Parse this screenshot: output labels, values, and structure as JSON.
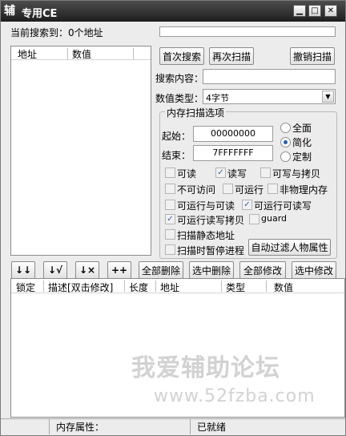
{
  "window": {
    "icon_glyph": "辅",
    "title": "专用CE",
    "minimize": "▁",
    "maximize": "□",
    "close": "✕"
  },
  "status_top": "当前搜索到：0个地址",
  "left_list": {
    "columns": [
      "地址",
      "数值"
    ]
  },
  "buttons": {
    "first_scan": "首次搜索",
    "next_scan": "再次扫描",
    "undo_scan": "撤销扫描",
    "auto_filter": "自动过滤人物属性"
  },
  "search": {
    "label": "搜索内容：",
    "value": ""
  },
  "value_type": {
    "label": "数值类型：",
    "selected": "4字节"
  },
  "mem_options": {
    "title": "内存扫描选项",
    "start_label": "起始：",
    "start_value": "00000000",
    "end_label": "结束：",
    "end_value": "7FFFFFFF",
    "radios": [
      {
        "label": "全面",
        "checked": false
      },
      {
        "label": "简化",
        "checked": true
      },
      {
        "label": "定制",
        "checked": false
      }
    ],
    "checks": {
      "readable": {
        "label": "可读",
        "checked": false
      },
      "readwrite": {
        "label": "读写",
        "checked": true
      },
      "writecopy": {
        "label": "可写与拷贝",
        "checked": false
      },
      "noaccess": {
        "label": "不可访问",
        "checked": false
      },
      "executable": {
        "label": "可运行",
        "checked": false
      },
      "nonphysical": {
        "label": "非物理内存",
        "checked": false
      },
      "exec_read": {
        "label": "可运行与可读",
        "checked": false
      },
      "exec_readwrite": {
        "label": "可运行可读写",
        "checked": true
      },
      "exec_rw_copy": {
        "label": "可运行读写拷贝",
        "checked": true
      },
      "guard": {
        "label": "guard",
        "checked": false
      },
      "static_addr": {
        "label": "扫描静态地址",
        "checked": false
      },
      "pause_scan": {
        "label": "扫描时暂停进程",
        "checked": false
      }
    }
  },
  "toolbar": {
    "down_arrow": "↓↓",
    "down_check": "↓√",
    "down_x": "↓×",
    "plus": "++",
    "delete_all": "全部删除",
    "delete_selected": "选中删除",
    "modify_all": "全部修改",
    "modify_selected": "选中修改"
  },
  "bottom_table": {
    "columns": [
      "锁定",
      "描述[双击修改]",
      "长度",
      "地址",
      "类型",
      "数值"
    ]
  },
  "watermark": {
    "title": "我爱辅助论坛",
    "url": "www.52fzba.com"
  },
  "statusbar": {
    "mem_attr": "内存属性：",
    "ready": "已就绪"
  }
}
